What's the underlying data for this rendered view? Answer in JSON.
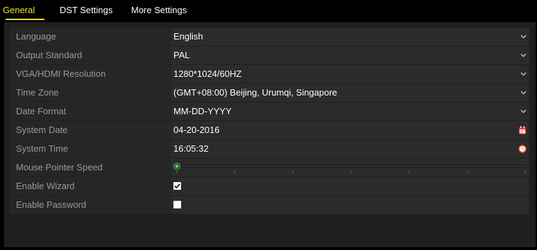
{
  "tabs": [
    {
      "label": "General",
      "active": true
    },
    {
      "label": "DST Settings",
      "active": false
    },
    {
      "label": "More Settings",
      "active": false
    }
  ],
  "settings": {
    "language": {
      "label": "Language",
      "value": "English"
    },
    "output_standard": {
      "label": "Output Standard",
      "value": "PAL"
    },
    "resolution": {
      "label": "VGA/HDMI Resolution",
      "value": "1280*1024/60HZ"
    },
    "time_zone": {
      "label": "Time Zone",
      "value": "(GMT+08:00) Beijing, Urumqi, Singapore"
    },
    "date_format": {
      "label": "Date Format",
      "value": "MM-DD-YYYY"
    },
    "system_date": {
      "label": "System Date",
      "value": "04-20-2016"
    },
    "system_time": {
      "label": "System Time",
      "value": "16:05:32"
    },
    "mouse_speed": {
      "label": "Mouse Pointer Speed",
      "level": 0.0
    },
    "enable_wizard": {
      "label": "Enable Wizard",
      "checked": true
    },
    "enable_password": {
      "label": "Enable Password",
      "checked": false
    }
  },
  "colors": {
    "accent": "#f0e42b",
    "slider_knob": "#4caf50",
    "calendar_icon": "#e53935",
    "clock_icon": "#ff7043"
  },
  "icons": {
    "dropdown": "chevron-down-icon",
    "date": "calendar-icon",
    "time": "clock-icon"
  }
}
